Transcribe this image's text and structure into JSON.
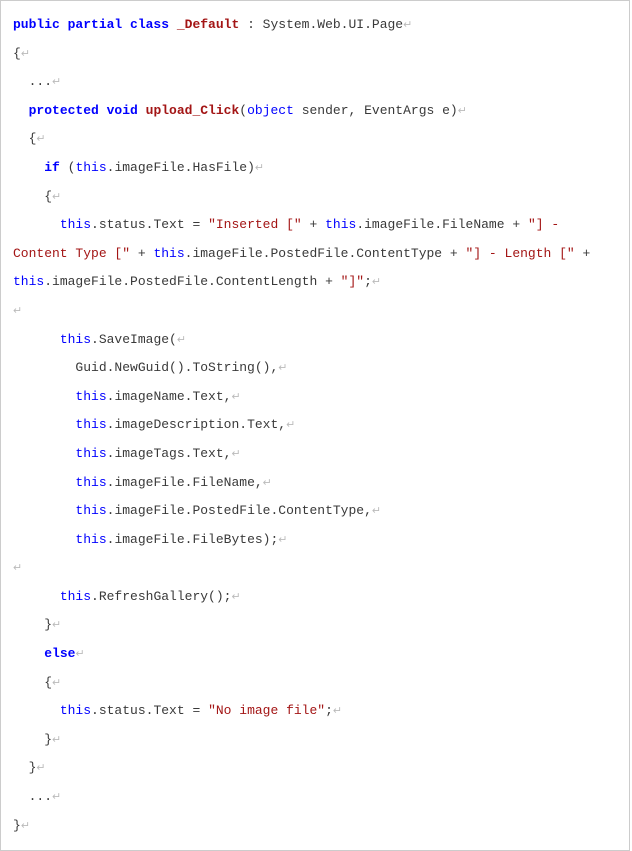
{
  "code": {
    "l1_keywords": "public partial class",
    "l1_classname": "_Default",
    "l1_rest": " : System.Web.UI.Page",
    "l2": "{",
    "l3": "  ...",
    "l4_keywords": "  protected void",
    "l4_method": "upload_Click",
    "l4_open": "(",
    "l4_objkw": "object",
    "l4_rest": " sender, EventArgs e)",
    "l5": "  {",
    "l6_if": "    if",
    "l6_open": " (",
    "l6_this": "this",
    "l6_rest": ".imageFile.HasFile)",
    "l7": "    {",
    "l8_this1": "      this",
    "l8_p1": ".status.Text = ",
    "l8_str1": "\"Inserted [\"",
    "l8_p2": " + ",
    "l8_this2": "this",
    "l8_p3": ".imageFile.FileName + ",
    "l8_str2": "\"] - Content Type [\"",
    "l8_p4": " + ",
    "l8_this3": "this",
    "l8_p5": ".imageFile.PostedFile.ContentType + ",
    "l8_str3": "\"] - Length [\"",
    "l8_p6": " + ",
    "l8_this4": "this",
    "l8_p7": ".imageFile.PostedFile.ContentLength + ",
    "l8_str4": "\"]\"",
    "l8_p8": ";",
    "l9": "",
    "l10_this": "      this",
    "l10_rest": ".SaveImage(",
    "l11": "        Guid.NewGuid().ToString(),",
    "l12_this": "        this",
    "l12_rest": ".imageName.Text,",
    "l13_this": "        this",
    "l13_rest": ".imageDescription.Text,",
    "l14_this": "        this",
    "l14_rest": ".imageTags.Text,",
    "l15_this": "        this",
    "l15_rest": ".imageFile.FileName,",
    "l16_this": "        this",
    "l16_rest": ".imageFile.PostedFile.ContentType,",
    "l17_this": "        this",
    "l17_rest": ".imageFile.FileBytes);",
    "l18": "",
    "l19_this": "      this",
    "l19_rest": ".RefreshGallery();",
    "l20": "    }",
    "l21_else": "    else",
    "l22": "    {",
    "l23_this": "      this",
    "l23_p1": ".status.Text = ",
    "l23_str": "\"No image file\"",
    "l23_p2": ";",
    "l24": "    }",
    "l25": "  }",
    "l26": "  ...",
    "l27": "}"
  },
  "ret": "↵"
}
